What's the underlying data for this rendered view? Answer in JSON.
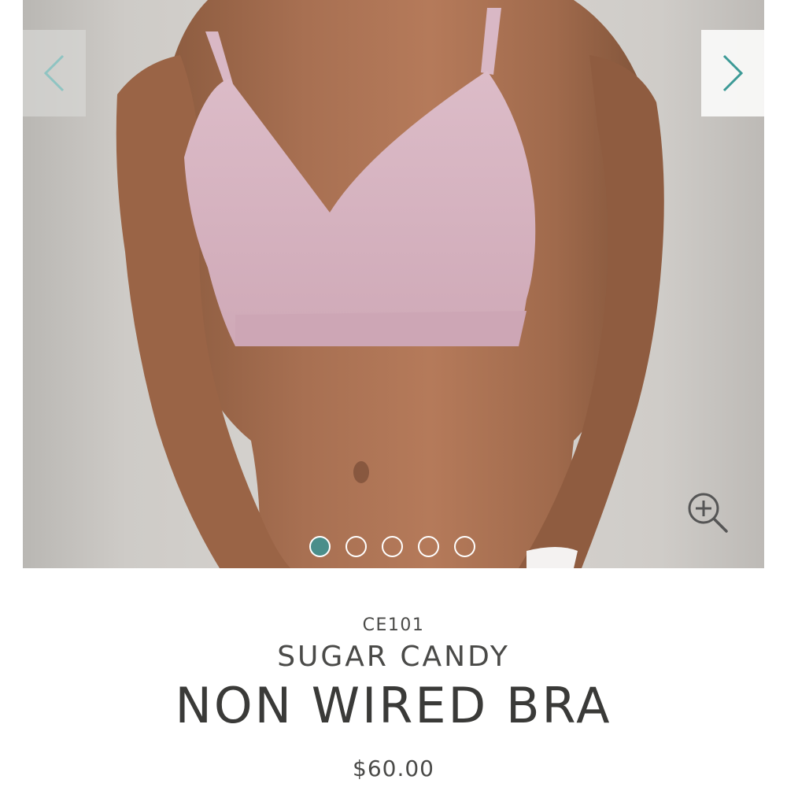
{
  "gallery": {
    "image_alt": "Model wearing pink non wired bra",
    "prev_icon": "chevron-left-icon",
    "next_icon": "chevron-right-icon",
    "zoom_icon": "zoom-in-icon",
    "slide_count": 5,
    "active_slide": 1,
    "accent_color": "#4a8e8a",
    "garment_color": "#d7b4c1"
  },
  "product": {
    "sku": "CE101",
    "collection": "SUGAR CANDY",
    "name": "NON WIRED BRA",
    "price": "$60.00"
  }
}
